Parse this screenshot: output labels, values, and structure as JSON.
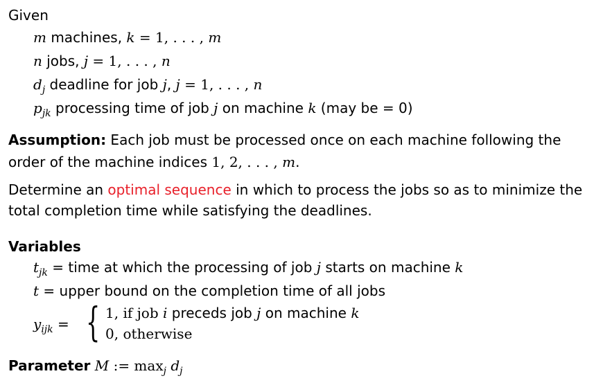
{
  "given": {
    "heading": "Given",
    "machines": {
      "var": "m",
      "text": " machines, ",
      "idx": "k",
      "range": " = 1, . . . , ",
      "end": "m"
    },
    "jobs": {
      "var": "n",
      "text": " jobs, ",
      "idx": "j",
      "range": " = 1, . . . , ",
      "end": "n"
    },
    "deadline": {
      "var": "d",
      "sub": "j",
      "text": " deadline for job ",
      "job": "j",
      "comma": ", ",
      "idx": "j",
      "range": " = 1, . . . , ",
      "end": "n"
    },
    "processing": {
      "var": "p",
      "sub": "jk",
      "text1": " processing time of job ",
      "job": "j",
      "text2": " on machine ",
      "mach": "k",
      "text3": " (may be = 0)"
    }
  },
  "assumption": {
    "label": "Assumption:",
    "line1": " Each job must be processed once on each machine following the",
    "line2_pre": "order of the machine indices ",
    "line2_math": "1, 2, . . . , ",
    "line2_var": "m",
    "line2_end": "."
  },
  "determine": {
    "pre": "Determine an ",
    "highlight": "optimal sequence",
    "post": " in which to process the jobs so as to minimize the",
    "line2": "total completion time while satisfying the deadlines."
  },
  "variables": {
    "heading": "Variables",
    "t_jk": {
      "var": "t",
      "sub": "jk",
      "text1": " = time at which the processing of job ",
      "job": "j",
      "text2": " starts on machine ",
      "mach": "k"
    },
    "t": {
      "var": "t",
      "text": " = upper bound on the completion time of all jobs"
    },
    "y": {
      "var": "y",
      "sub": "ijk",
      "eq": " =",
      "case1_pre": "1,  if job ",
      "case1_i": "i",
      "case1_mid": " preceds job ",
      "case1_j": "j",
      "case1_on": " on machine ",
      "case1_k": "k",
      "case2": "0,  otherwise"
    }
  },
  "parameter": {
    "label": "Parameter",
    "var": "M",
    "def": " := max",
    "sub": "j",
    "dvar": "d",
    "dsub": "j"
  }
}
